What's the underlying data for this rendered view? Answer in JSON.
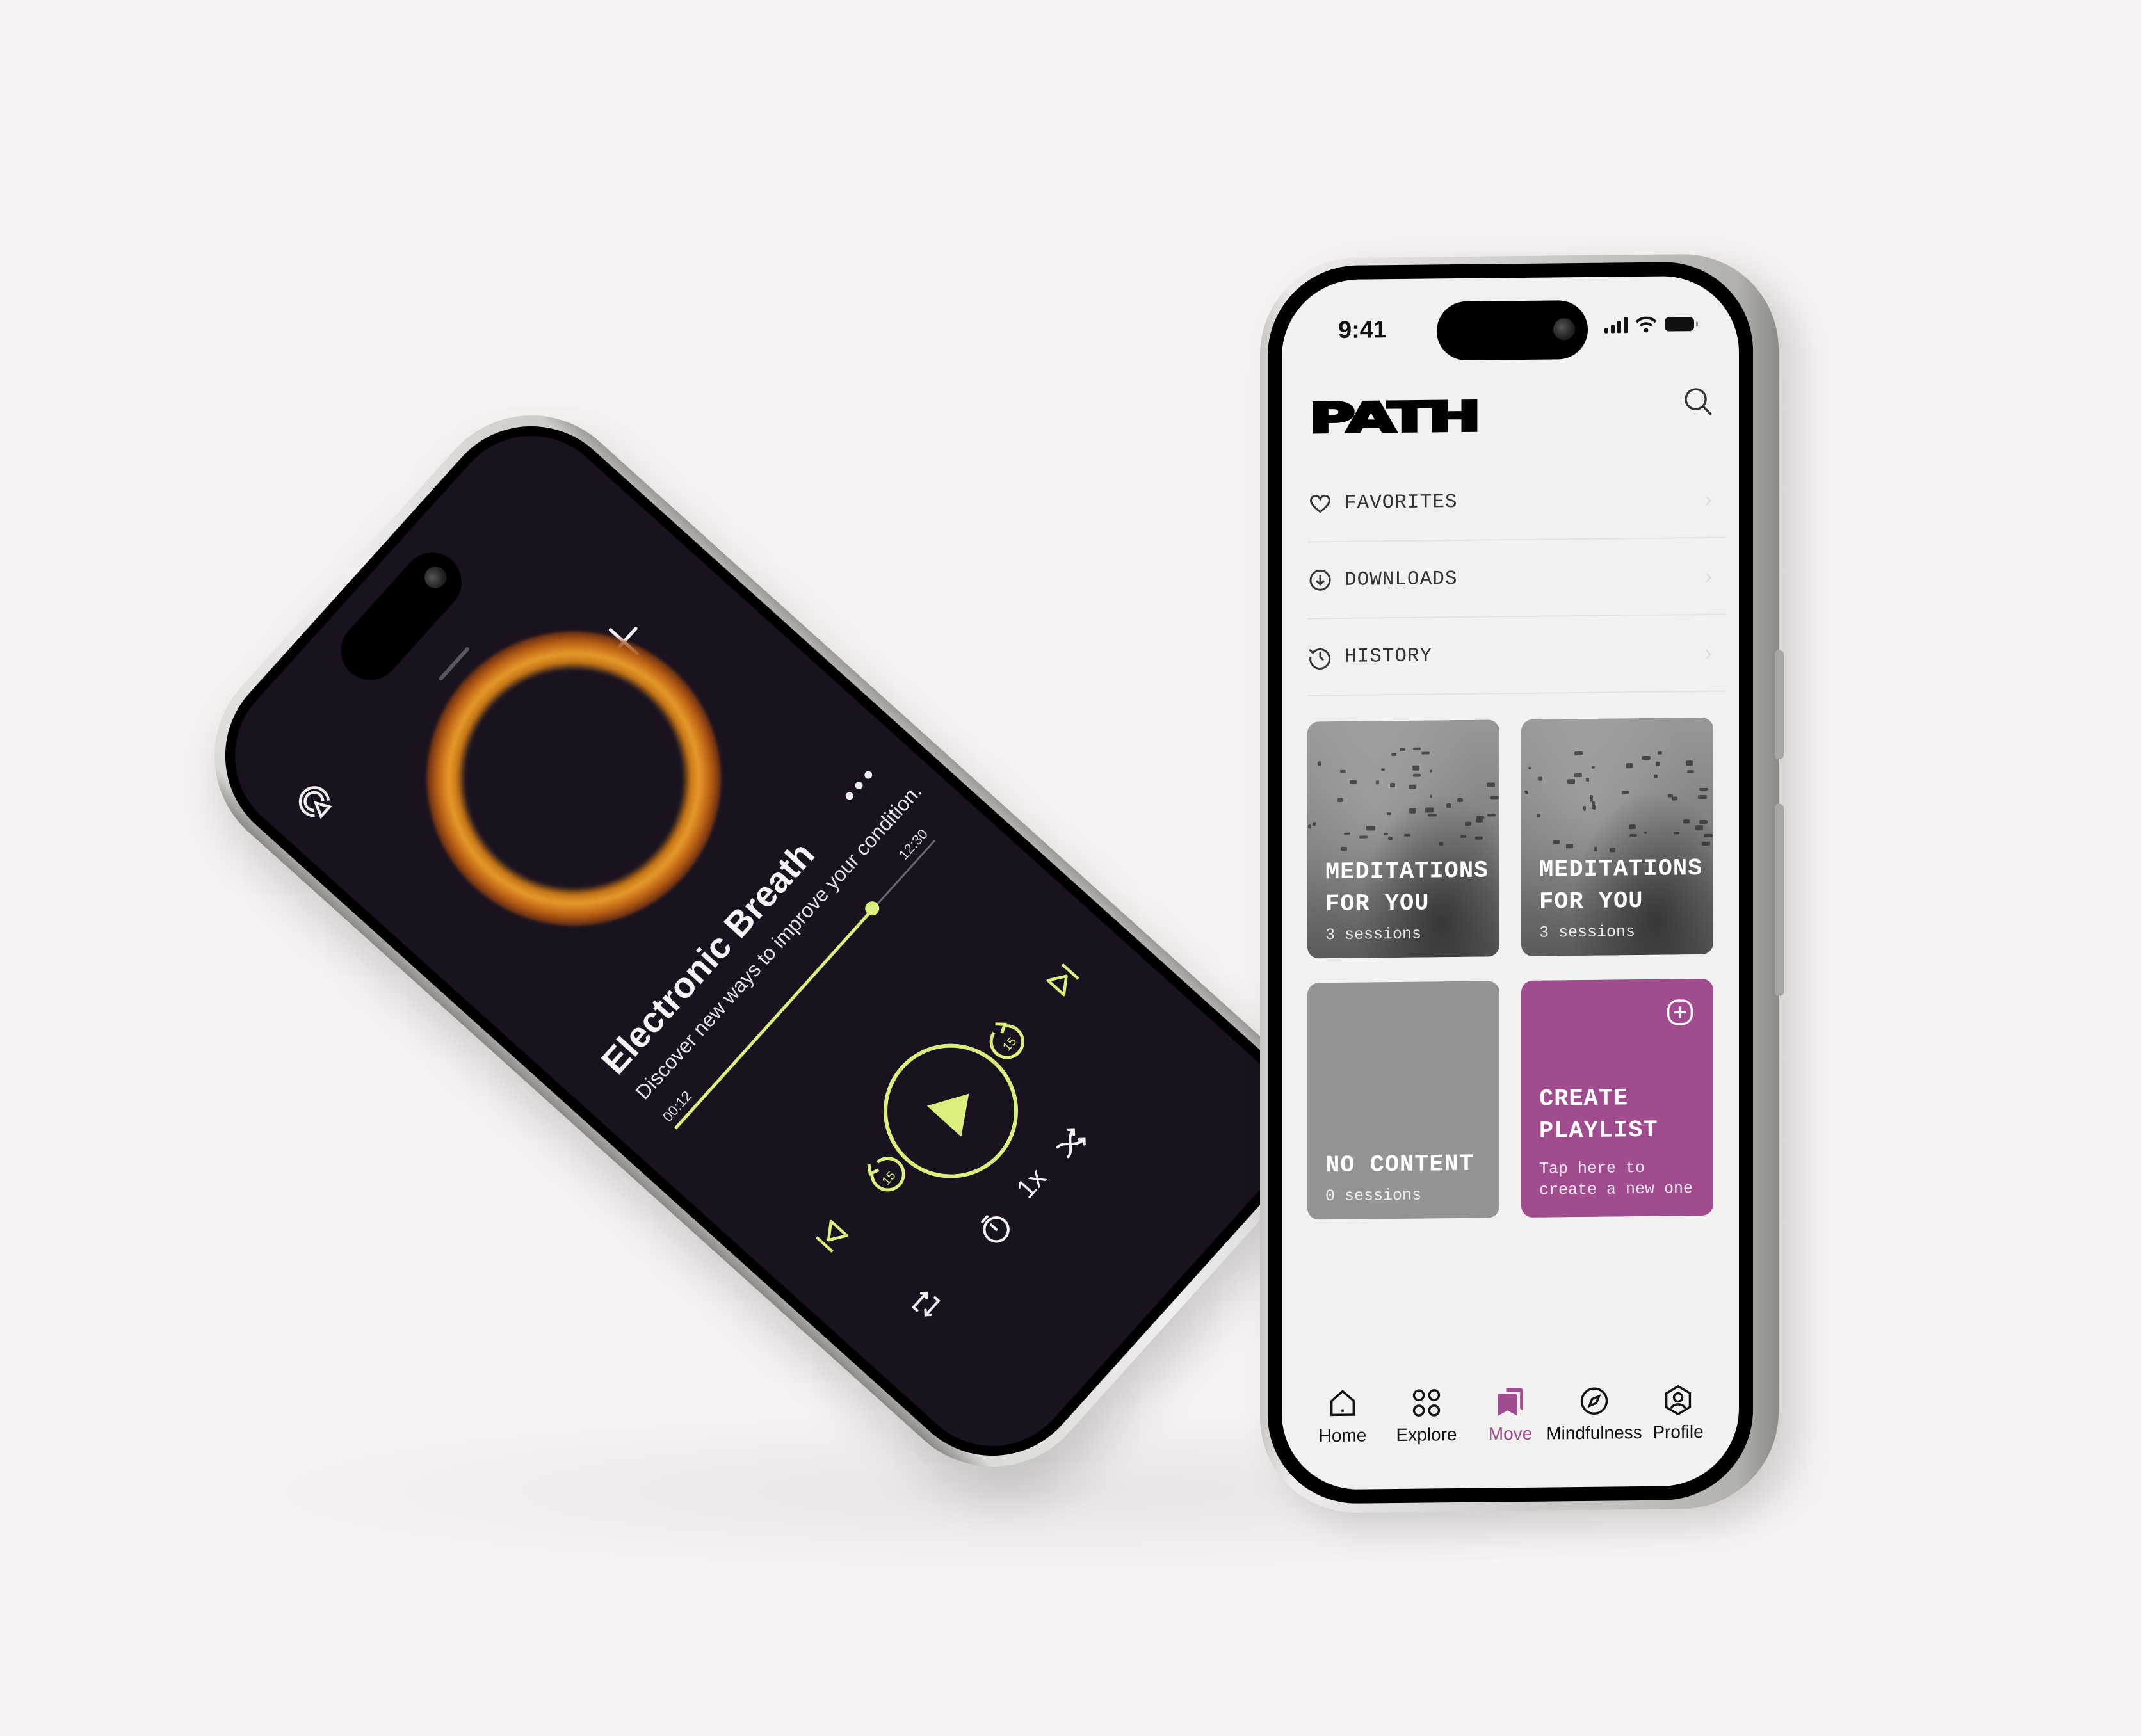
{
  "player": {
    "title": "Electronic Breath",
    "subtitle": "Discover new ways to improve your condition.",
    "elapsed": "00:12",
    "duration": "12:30",
    "progress_fraction": 0.76,
    "skip_back_seconds": "15",
    "skip_forward_seconds": "15",
    "speed": "1x",
    "icons": [
      "airplay-icon",
      "minimize-icon",
      "close-icon",
      "more-icon",
      "previous-icon",
      "rewind-15-icon",
      "play-icon",
      "forward-15-icon",
      "next-icon",
      "repeat-icon",
      "timer-icon",
      "speed-icon",
      "shuffle-icon"
    ],
    "accent_color": "#dbef7d",
    "background_color": "#1a131f"
  },
  "library": {
    "status_time": "9:41",
    "logo": "PATH",
    "menu": [
      {
        "label": "FAVORITES",
        "icon": "heart-icon"
      },
      {
        "label": "DOWNLOADS",
        "icon": "download-icon"
      },
      {
        "label": "HISTORY",
        "icon": "history-icon"
      }
    ],
    "cards": [
      {
        "title_line1": "MEDITATIONS",
        "title_line2": "FOR YOU",
        "subtitle": "3 sessions"
      },
      {
        "title_line1": "MEDITATIONS",
        "title_line2": "FOR YOU",
        "subtitle": "3 sessions"
      },
      {
        "title_line1": "NO CONTENT",
        "title_line2": "",
        "subtitle": "0 sessions"
      },
      {
        "title_line1": "CREATE",
        "title_line2": "PLAYLIST",
        "subtitle": "Tap here to create a new one"
      }
    ],
    "tabs": [
      {
        "label": "Home",
        "icon": "home-icon"
      },
      {
        "label": "Explore",
        "icon": "grid-icon"
      },
      {
        "label": "Move",
        "icon": "bookmarks-icon",
        "active": true
      },
      {
        "label": "Mindfulness",
        "icon": "compass-icon"
      },
      {
        "label": "Profile",
        "icon": "profile-icon"
      }
    ],
    "accent_color": "#a24c90"
  }
}
